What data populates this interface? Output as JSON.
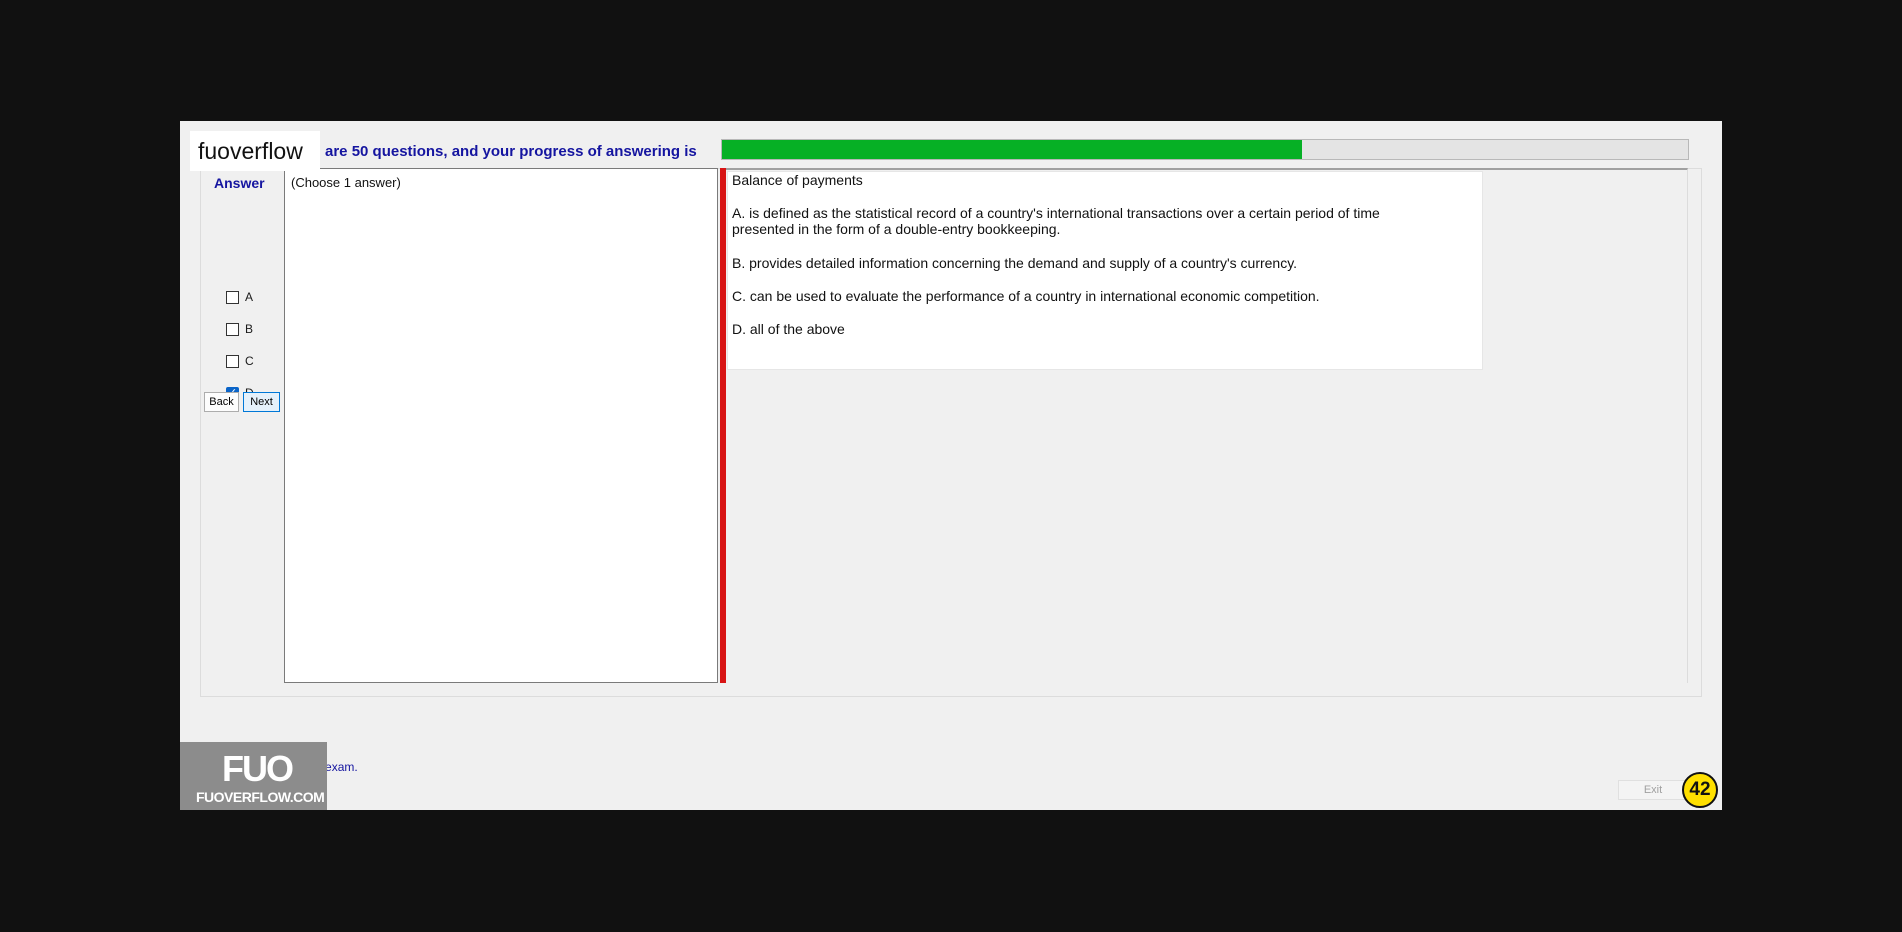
{
  "watermark_top": "fuoverflow",
  "progress": {
    "text": "are 50 questions, and your progress of answering is",
    "fraction": 0.6,
    "fill_color": "#06b025"
  },
  "answer_panel": {
    "title": "Answer",
    "options": [
      {
        "label": "A",
        "checked": false
      },
      {
        "label": "B",
        "checked": false
      },
      {
        "label": "C",
        "checked": false
      },
      {
        "label": "D",
        "checked": true
      }
    ],
    "back_label": "Back",
    "next_label": "Next"
  },
  "choose_note": "(Choose 1 answer)",
  "question": {
    "title": "Balance of payments",
    "a_line1": "A.  is defined as the statistical record of a country's international transactions over a certain period of time",
    "a_line2": "presented in the form of a double-entry bookkeeping.",
    "b": "B.  provides detailed information concerning the demand and supply of a country's currency.",
    "c": "C.  can be used to evaluate the performance of a country in international economic competition.",
    "d": "D.  all of the above"
  },
  "finish": {
    "label": "I want to finish the exam."
  },
  "bottom_badge": {
    "logo": "FUO",
    "url": "FUOVERFLOW.COM"
  },
  "exit_label": "Exit",
  "question_number": "42",
  "colors": {
    "accent_text": "#1515a0",
    "splitter": "#d81414",
    "badge": "#ffe000"
  }
}
